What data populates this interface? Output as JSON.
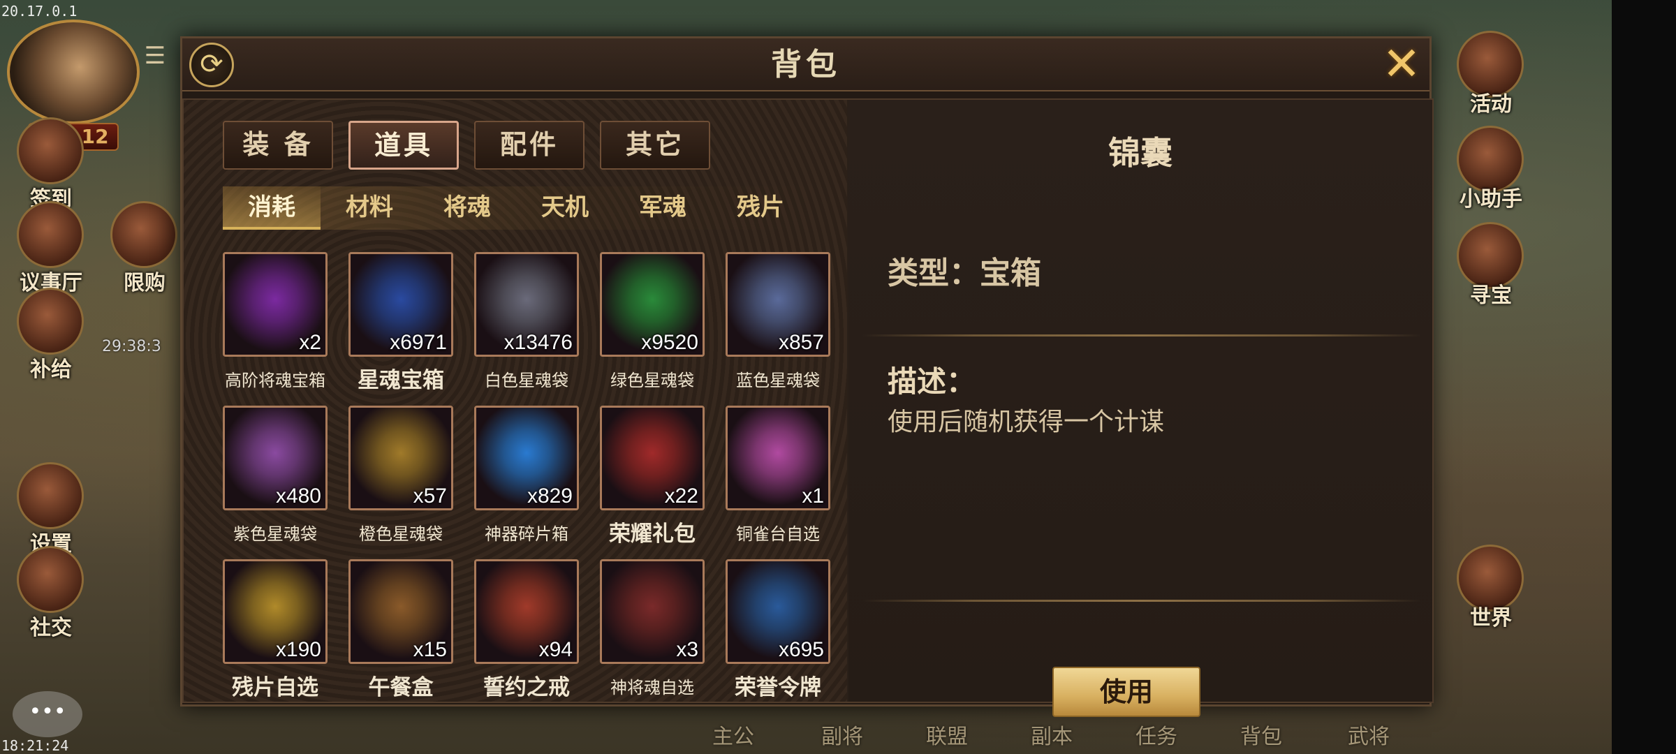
{
  "status": {
    "version": "20.17.0.1",
    "clock": "18:21:24"
  },
  "hud": {
    "vip": "VIP 12",
    "left_icons": [
      {
        "label": "签到",
        "name": "sign-in"
      },
      {
        "label": "议事厅",
        "name": "council-hall"
      },
      {
        "label": "限购",
        "name": "limited-purchase"
      },
      {
        "label": "补给",
        "name": "supply"
      },
      {
        "label": "设置",
        "name": "settings"
      },
      {
        "label": "社交",
        "name": "social"
      }
    ],
    "limited_timer": "29:38:3",
    "right_icons": [
      {
        "label": "活动",
        "name": "events"
      },
      {
        "label": "小助手",
        "name": "assistant"
      },
      {
        "label": "寻宝",
        "name": "treasure-hunt"
      },
      {
        "label": "世界",
        "name": "world"
      }
    ],
    "bottom_nav": [
      "主公",
      "副将",
      "联盟",
      "副本",
      "任务",
      "背包",
      "武将"
    ]
  },
  "dialog": {
    "title": "背包",
    "main_tabs": [
      "装 备",
      "道具",
      "配件",
      "其它"
    ],
    "active_main_tab": 1,
    "sub_tabs": [
      "消耗",
      "材料",
      "将魂",
      "天机",
      "军魂",
      "残片"
    ],
    "active_sub_tab": 0,
    "items": [
      {
        "name": "高阶将魂宝箱",
        "count": "x2",
        "color": "#7b2aa0",
        "big": false
      },
      {
        "name": "星魂宝箱",
        "count": "x6971",
        "color": "#2a4aa0",
        "big": true
      },
      {
        "name": "白色星魂袋",
        "count": "x13476",
        "color": "#6a6a7a",
        "big": false
      },
      {
        "name": "绿色星魂袋",
        "count": "x9520",
        "color": "#2a8a3a",
        "big": false
      },
      {
        "name": "蓝色星魂袋",
        "count": "x857",
        "color": "#5a6a9a",
        "big": false
      },
      {
        "name": "紫色星魂袋",
        "count": "x480",
        "color": "#8a4aa0",
        "big": false
      },
      {
        "name": "橙色星魂袋",
        "count": "x57",
        "color": "#a07a2a",
        "big": false
      },
      {
        "name": "神器碎片箱",
        "count": "x829",
        "color": "#2a7ad0",
        "big": false
      },
      {
        "name": "荣耀礼包",
        "count": "x22",
        "color": "#a02a2a",
        "big": true
      },
      {
        "name": "铜雀台自选",
        "count": "x1",
        "color": "#b04aa0",
        "big": false
      },
      {
        "name": "残片自选",
        "count": "x190",
        "color": "#b08a2a",
        "big": true
      },
      {
        "name": "午餐盒",
        "count": "x15",
        "color": "#8a5a2a",
        "big": true
      },
      {
        "name": "誓约之戒",
        "count": "x94",
        "color": "#a03a2a",
        "big": true
      },
      {
        "name": "神将魂自选",
        "count": "x3",
        "color": "#7a2a2a",
        "big": false
      },
      {
        "name": "荣誉令牌",
        "count": "x695",
        "color": "#2a5a9a",
        "big": true
      }
    ],
    "detail": {
      "title": "锦囊",
      "type": "类型：宝箱",
      "desc_label": "描述：",
      "desc_text": "使用后随机获得一个计谋",
      "use_button": "使用"
    }
  }
}
